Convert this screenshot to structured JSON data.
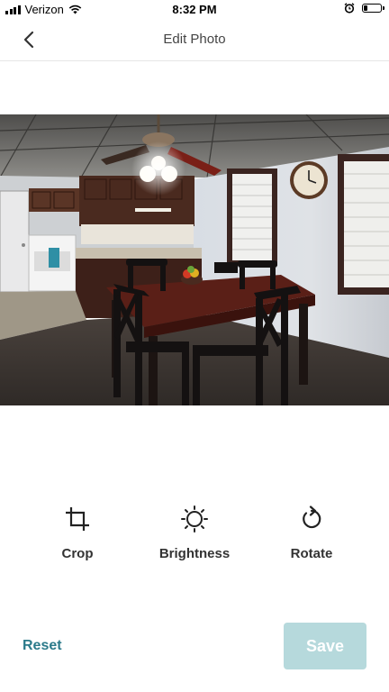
{
  "status_bar": {
    "carrier": "Verizon",
    "time": "8:32 PM",
    "battery_level": 0.2,
    "icons": [
      "signal-icon",
      "wifi-icon",
      "alarm-icon",
      "battery-icon"
    ]
  },
  "nav": {
    "title": "Edit Photo",
    "back_icon": "chevron-left-icon"
  },
  "photo": {
    "subject": "dining room with dark wood table, chairs, ceiling fan and kitchen"
  },
  "tools": [
    {
      "label": "Crop",
      "icon": "crop-icon"
    },
    {
      "label": "Brightness",
      "icon": "sun-icon"
    },
    {
      "label": "Rotate",
      "icon": "rotate-icon"
    }
  ],
  "footer": {
    "reset_label": "Reset",
    "save_label": "Save"
  },
  "colors": {
    "accent": "#2b7a8a",
    "save_disabled_bg": "#b6d9dc"
  }
}
